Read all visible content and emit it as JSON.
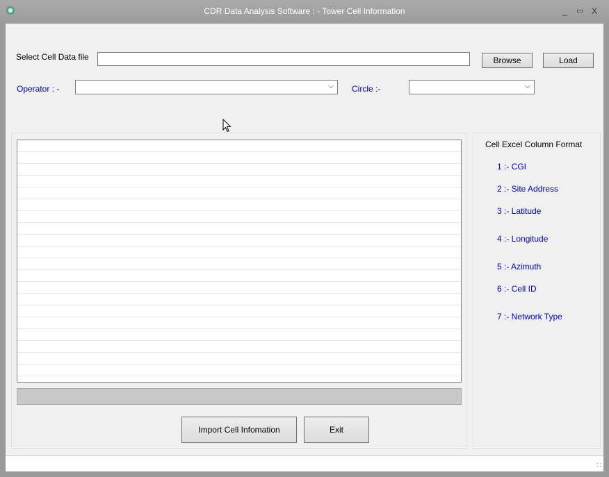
{
  "window": {
    "title": "CDR Data Analysis Software : - Tower Cell Information",
    "controls": {
      "minimize": "_",
      "maximize": "▭",
      "close": "X"
    }
  },
  "file": {
    "label": "Select Cell Data file",
    "value": "",
    "browse_label": "Browse",
    "load_label": "Load"
  },
  "operator": {
    "label": "Operator : -",
    "selected": ""
  },
  "circle": {
    "label": "Circle :-",
    "selected": ""
  },
  "grid": {
    "rows": 20
  },
  "format": {
    "title": "Cell Excel Column Format",
    "items": [
      "1 :- CGI",
      "2 :- Site Address",
      "3 :- Latitude",
      "4 :- Longitude",
      "5 :- Azimuth",
      "6 :- Cell ID",
      "7 :- Network Type"
    ]
  },
  "actions": {
    "import_label": "Import Cell Infomation",
    "exit_label": "Exit"
  },
  "progress": {
    "value": 0
  },
  "status": {
    "text": ""
  },
  "colors": {
    "label_blue": "#0000c8",
    "titlebar": "#9c9c9c",
    "window_bg": "#f0f0f0"
  }
}
